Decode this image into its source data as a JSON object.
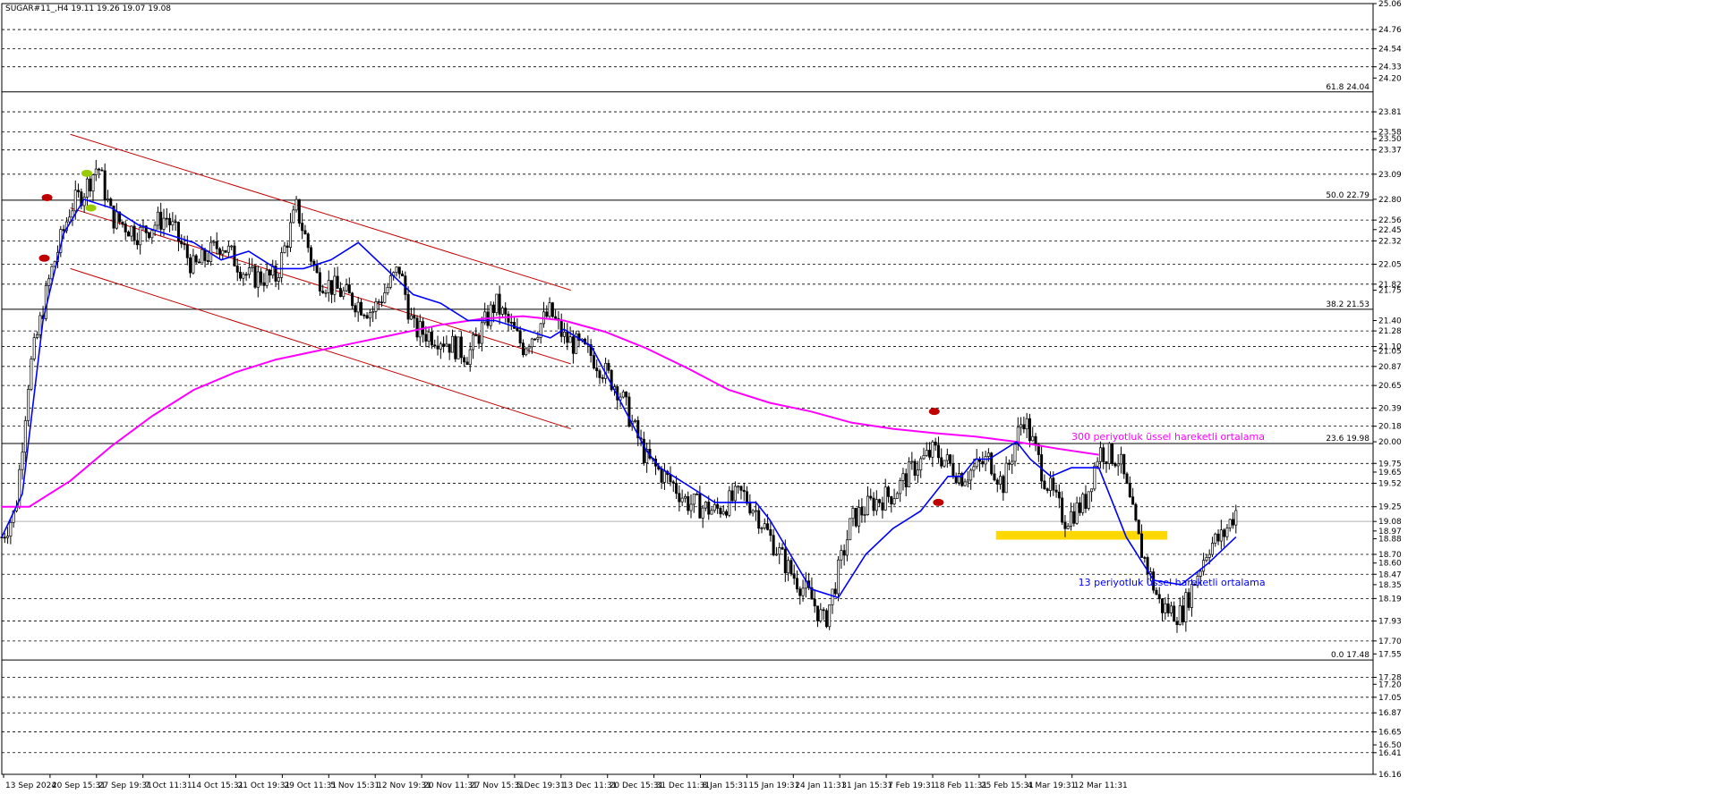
{
  "header": {
    "symbol_label": "SUGAR#11_,H4  19.11 19.26 19.07 19.08"
  },
  "colors": {
    "background": "#ffffff",
    "grid": "#000000",
    "candle": "#000000",
    "ema13": "#0000ff",
    "ema300": "#ff00ff",
    "channel": "#c00000",
    "highlight_band": "#ffd800",
    "marker_red": "#c00000",
    "marker_green": "#99cc00"
  },
  "chart_data": {
    "type": "candlestick",
    "instrument": "SUGAR#11_",
    "timeframe": "H4",
    "ohlc_header": {
      "open": 19.11,
      "high": 19.26,
      "low": 19.07,
      "close": 19.08
    },
    "ylim": [
      16.16,
      25.06
    ],
    "price_axis_labels": [
      "25.06",
      "24.76",
      "24.54",
      "24.33",
      "24.20",
      "23.81",
      "23.58",
      "23.50",
      "23.37",
      "23.09",
      "22.80",
      "22.56",
      "22.45",
      "22.32",
      "22.05",
      "21.82",
      "21.75",
      "21.40",
      "21.28",
      "21.10",
      "21.05",
      "20.87",
      "20.65",
      "20.39",
      "20.18",
      "20.00",
      "19.75",
      "19.65",
      "19.52",
      "19.25",
      "19.08",
      "18.97",
      "18.88",
      "18.70",
      "18.60",
      "18.47",
      "18.35",
      "18.19",
      "17.93",
      "17.70",
      "17.55",
      "17.28",
      "17.20",
      "17.05",
      "16.87",
      "16.65",
      "16.50",
      "16.41",
      "16.16"
    ],
    "dashed_grid_levels": [
      25.06,
      24.76,
      24.54,
      24.33,
      23.81,
      23.58,
      23.37,
      23.09,
      22.56,
      22.32,
      22.05,
      21.82,
      21.28,
      21.1,
      20.87,
      20.65,
      20.39,
      20.18,
      19.75,
      19.52,
      19.25,
      18.7,
      18.47,
      18.19,
      17.93,
      17.7,
      17.28,
      17.05,
      16.87,
      16.65,
      16.41,
      16.16
    ],
    "solid_levels": [
      {
        "value": 24.04,
        "label": "61.8 24.04"
      },
      {
        "value": 22.79,
        "label": "50.0 22.79"
      },
      {
        "value": 21.53,
        "label": "38.2 21.53"
      },
      {
        "value": 19.98,
        "label": "23.6 19.98"
      },
      {
        "value": 17.48,
        "label": "0.0 17.48"
      }
    ],
    "current_price_level": 19.08,
    "x_labels": [
      "13 Sep 2024",
      "20 Sep 15:31",
      "27 Sep 19:31",
      "7 Oct 11:31",
      "14 Oct 15:31",
      "21 Oct 19:31",
      "29 Oct 11:31",
      "5 Nov 15:31",
      "12 Nov 19:31",
      "20 Nov 11:31",
      "27 Nov 15:31",
      "5 Dec 19:31",
      "13 Dec 11:31",
      "20 Dec 15:31",
      "31 Dec 11:31",
      "8 Jan 15:31",
      "15 Jan 19:31",
      "24 Jan 11:31",
      "31 Jan 15:31",
      "7 Feb 19:31",
      "18 Feb 11:31",
      "25 Feb 15:31",
      "4 Mar 19:31",
      "12 Mar 11:31"
    ],
    "close_path_t": [
      0,
      0.01,
      0.02,
      0.035,
      0.05,
      0.06,
      0.07,
      0.08,
      0.09,
      0.1,
      0.12,
      0.14,
      0.16,
      0.18,
      0.2,
      0.215,
      0.23,
      0.25,
      0.27,
      0.29,
      0.3,
      0.32,
      0.34,
      0.36,
      0.38,
      0.39,
      0.4,
      0.41,
      0.43,
      0.45,
      0.47,
      0.49,
      0.5,
      0.52,
      0.54,
      0.55,
      0.56,
      0.575,
      0.59,
      0.6,
      0.61,
      0.62,
      0.635,
      0.65,
      0.665,
      0.68,
      0.7,
      0.72,
      0.73,
      0.745,
      0.76,
      0.775,
      0.79,
      0.8,
      0.815,
      0.83,
      0.845,
      0.86,
      0.87,
      0.88,
      0.89,
      0.9
    ],
    "close_path_y": [
      18.9,
      19.2,
      20.8,
      21.9,
      22.7,
      22.9,
      23.2,
      22.6,
      22.5,
      22.4,
      22.6,
      22.0,
      22.3,
      21.9,
      21.9,
      22.7,
      21.9,
      21.7,
      21.5,
      22.0,
      21.3,
      21.2,
      21.0,
      21.6,
      21.1,
      21.3,
      21.5,
      21.2,
      21.0,
      20.6,
      19.8,
      19.5,
      19.3,
      19.2,
      19.4,
      19.2,
      18.9,
      18.5,
      18.2,
      17.9,
      18.5,
      19.1,
      19.3,
      19.4,
      19.7,
      19.9,
      19.6,
      19.8,
      19.5,
      20.3,
      19.6,
      19.1,
      19.3,
      19.9,
      19.8,
      18.8,
      18.1,
      18.0,
      18.4,
      18.8,
      18.9,
      19.2
    ],
    "ema13_t": [
      0,
      0.015,
      0.03,
      0.045,
      0.06,
      0.08,
      0.1,
      0.12,
      0.14,
      0.16,
      0.18,
      0.2,
      0.22,
      0.24,
      0.26,
      0.28,
      0.3,
      0.32,
      0.34,
      0.36,
      0.38,
      0.39,
      0.4,
      0.41,
      0.43,
      0.44,
      0.45,
      0.47,
      0.48,
      0.5,
      0.52,
      0.53,
      0.55,
      0.56,
      0.575,
      0.59,
      0.61,
      0.63,
      0.65,
      0.67,
      0.68,
      0.69,
      0.7,
      0.71,
      0.72,
      0.74,
      0.75,
      0.765,
      0.78,
      0.8,
      0.82,
      0.84,
      0.86,
      0.88,
      0.9
    ],
    "ema13_y": [
      18.9,
      19.4,
      21.4,
      22.4,
      22.8,
      22.7,
      22.5,
      22.4,
      22.3,
      22.1,
      22.2,
      22.0,
      22.0,
      22.1,
      22.3,
      22.0,
      21.7,
      21.6,
      21.4,
      21.4,
      21.3,
      21.25,
      21.2,
      21.3,
      21.1,
      20.8,
      20.5,
      19.9,
      19.7,
      19.5,
      19.3,
      19.3,
      19.3,
      19.1,
      18.7,
      18.3,
      18.2,
      18.7,
      19.0,
      19.2,
      19.4,
      19.6,
      19.6,
      19.8,
      19.8,
      20.0,
      19.8,
      19.6,
      19.7,
      19.7,
      18.9,
      18.4,
      18.35,
      18.6,
      18.9
    ],
    "ema300_t": [
      0,
      0.02,
      0.05,
      0.08,
      0.11,
      0.14,
      0.17,
      0.2,
      0.23,
      0.26,
      0.29,
      0.32,
      0.35,
      0.38,
      0.41,
      0.44,
      0.47,
      0.5,
      0.53,
      0.56,
      0.59,
      0.62,
      0.65,
      0.68,
      0.71,
      0.74,
      0.77,
      0.8
    ],
    "ema300_y": [
      19.25,
      19.25,
      19.55,
      19.95,
      20.3,
      20.6,
      20.8,
      20.95,
      21.05,
      21.15,
      21.25,
      21.35,
      21.42,
      21.45,
      21.4,
      21.27,
      21.08,
      20.85,
      20.6,
      20.45,
      20.35,
      20.22,
      20.15,
      20.1,
      20.06,
      20.0,
      19.92,
      19.85
    ],
    "channel_lines": [
      {
        "name": "upper",
        "t0": 0.05,
        "y0": 23.55,
        "t1": 0.415,
        "y1": 21.75
      },
      {
        "name": "middle",
        "t0": 0.05,
        "y0": 22.7,
        "t1": 0.415,
        "y1": 20.9
      },
      {
        "name": "lower",
        "t0": 0.05,
        "y0": 22.0,
        "t1": 0.415,
        "y1": 20.15
      }
    ],
    "highlight_band": {
      "t0": 0.725,
      "t1": 0.85,
      "y_low": 18.87,
      "y_high": 18.97
    },
    "markers": [
      {
        "name": "marker-red-1",
        "t": 0.033,
        "y": 22.82,
        "color": "red"
      },
      {
        "name": "marker-red-2",
        "t": 0.031,
        "y": 22.12,
        "color": "red"
      },
      {
        "name": "marker-green-1",
        "t": 0.062,
        "y": 23.1,
        "color": "green"
      },
      {
        "name": "marker-green-2",
        "t": 0.065,
        "y": 22.7,
        "color": "green"
      },
      {
        "name": "marker-red-3",
        "t": 0.68,
        "y": 20.35,
        "color": "red"
      },
      {
        "name": "marker-red-4",
        "t": 0.683,
        "y": 19.3,
        "color": "red"
      }
    ],
    "annotations": [
      {
        "text": "300 periyotluk üssel hareketli ortalama",
        "t": 0.78,
        "y": 20.02,
        "color": "#ff00ff"
      },
      {
        "text": "13 periyotluk üssel hareketli ortalama",
        "t": 0.785,
        "y": 18.34,
        "color": "#0000ff"
      }
    ]
  }
}
